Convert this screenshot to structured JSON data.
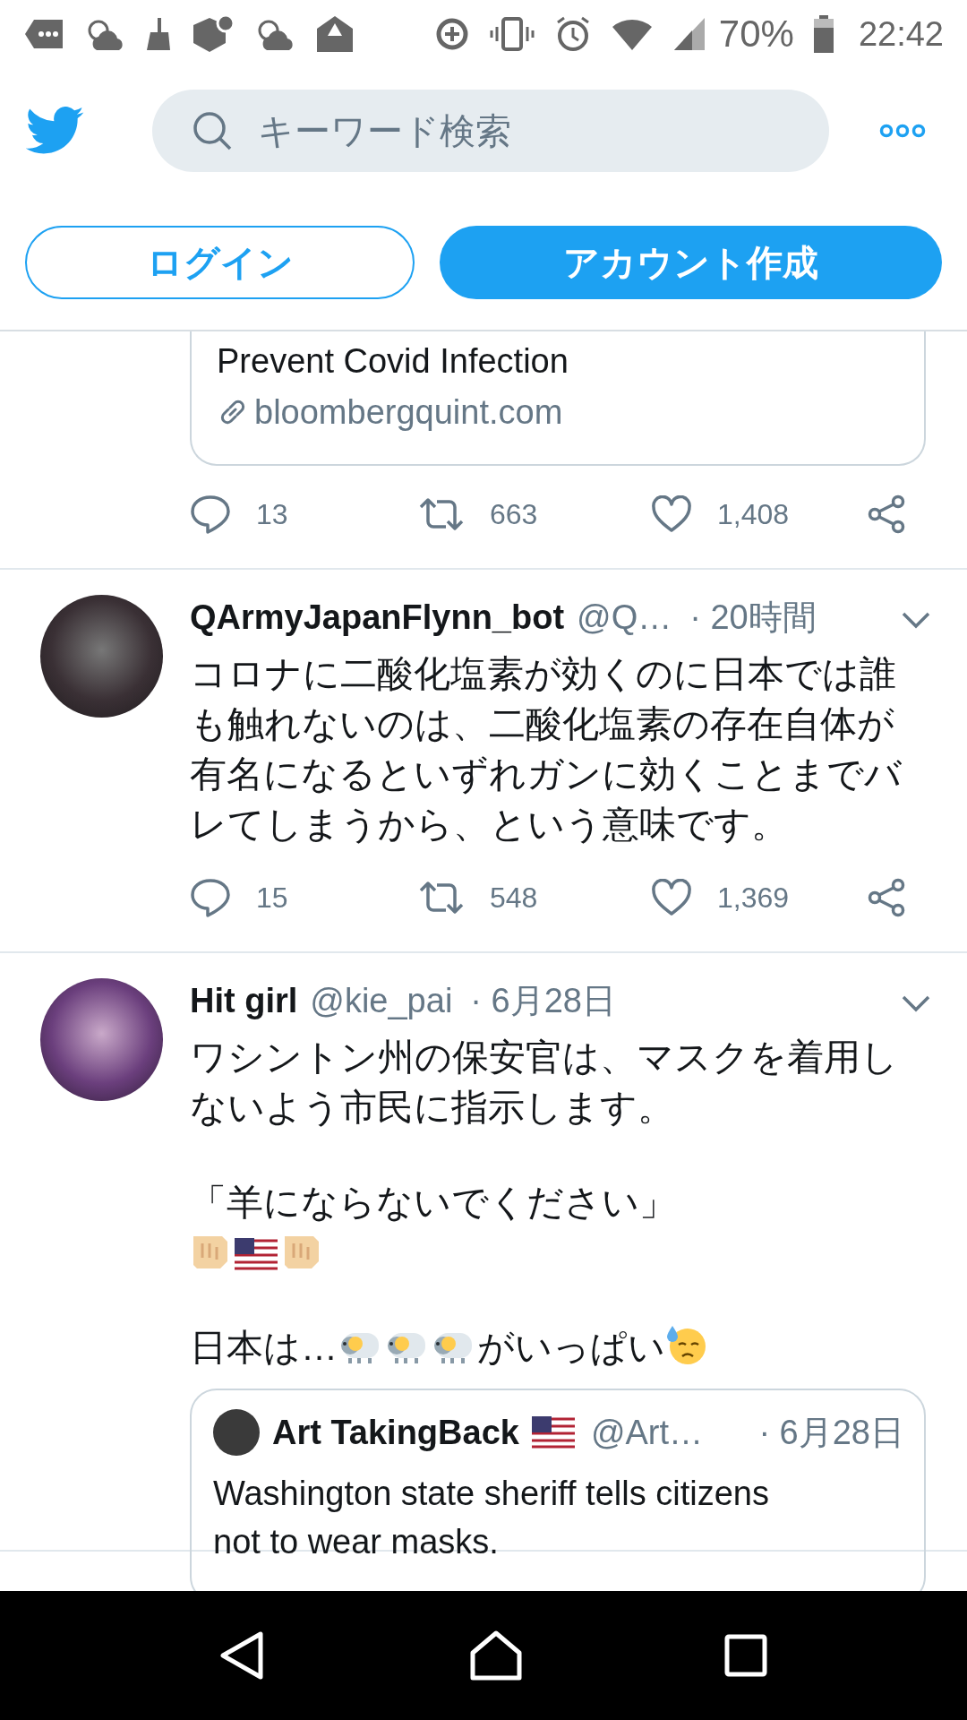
{
  "status_bar": {
    "battery": "70%",
    "time": "22:42"
  },
  "header": {
    "search": {
      "placeholder": "キーワード検索"
    }
  },
  "auth_buttons": [
    {
      "label": "ログイン",
      "kind": "outline"
    },
    {
      "label": "アカウント作成",
      "kind": "filled"
    }
  ],
  "partial_tweet": {
    "card": {
      "title": "Prevent Covid Infection",
      "domain": "bloombergquint.com"
    },
    "replies": "13",
    "retweets": "663",
    "likes": "1,408"
  },
  "tweets": [
    {
      "name": "QArmyJapanFlynn_bot",
      "handle": "@Q…",
      "time": "· 20時間",
      "replies": "15",
      "retweets": "548",
      "likes": "1,369",
      "body": [
        [
          [
            {
              "kind": "text",
              "text": "コロナに二酸化塩素が効くのに日本では誰も触れないのは、二酸化塩素の存在自体が有名になるといずれガンに効くことまでバレてしまうから、という意味です。"
            }
          ]
        ]
      ]
    },
    {
      "name": "Hit girl",
      "handle": "@kie_pai",
      "time": "· 6月28日",
      "body": [
        [
          [
            {
              "kind": "text",
              "text": "ワシントン州の保安官は、マスクを着用しないよう市民に指示します。"
            }
          ]
        ],
        [
          [
            {
              "kind": "text",
              "text": "「羊にならないでください」"
            }
          ],
          [
            {
              "kind": "fist"
            },
            {
              "kind": "flag"
            },
            {
              "kind": "fist"
            }
          ]
        ],
        [
          [
            {
              "kind": "text",
              "text": "日本は…"
            },
            {
              "kind": "sheep"
            },
            {
              "kind": "sheep"
            },
            {
              "kind": "sheep"
            },
            {
              "kind": "text",
              "text": "がいっぱい"
            },
            {
              "kind": "sweat-face"
            }
          ]
        ]
      ],
      "quote": {
        "name": "Art TakingBack",
        "handle": "@Art…",
        "time": "· 6月28日",
        "text": "Washington state sheriff tells citizens not to wear masks."
      }
    }
  ]
}
